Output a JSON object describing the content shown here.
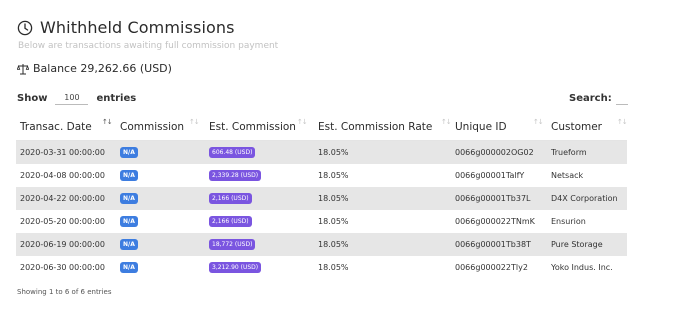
{
  "header": {
    "title": "Whithheld Commissions",
    "subtitle": "Below are transactions awaiting full commission payment"
  },
  "balance": {
    "text": "Balance 29,262.66 (USD)"
  },
  "controls": {
    "show_label": "Show",
    "entries_value": "100",
    "entries_label": "entries",
    "search_label": "Search:"
  },
  "table": {
    "columns": [
      "Transac. Date",
      "Commission",
      "Est. Commission",
      "Est. Commission Rate",
      "Unique ID",
      "Customer"
    ],
    "rows": [
      {
        "date": "2020-03-31 00:00:00",
        "commission": "N/A",
        "est_commission": "606.48 (USD)",
        "rate": "18.05%",
        "unique_id": "0066g000002OG02",
        "customer": "Trueform"
      },
      {
        "date": "2020-04-08 00:00:00",
        "commission": "N/A",
        "est_commission": "2,339.28 (USD)",
        "rate": "18.05%",
        "unique_id": "0066g00001TalfY",
        "customer": "Netsack"
      },
      {
        "date": "2020-04-22 00:00:00",
        "commission": "N/A",
        "est_commission": "2,166 (USD)",
        "rate": "18.05%",
        "unique_id": "0066g00001Tb37L",
        "customer": "D4X Corporation"
      },
      {
        "date": "2020-05-20 00:00:00",
        "commission": "N/A",
        "est_commission": "2,166 (USD)",
        "rate": "18.05%",
        "unique_id": "0066g000022TNmK",
        "customer": "Ensurion"
      },
      {
        "date": "2020-06-19 00:00:00",
        "commission": "N/A",
        "est_commission": "18,772 (USD)",
        "rate": "18.05%",
        "unique_id": "0066g00001Tb38T",
        "customer": "Pure Storage"
      },
      {
        "date": "2020-06-30 00:00:00",
        "commission": "N/A",
        "est_commission": "3,212.90 (USD)",
        "rate": "18.05%",
        "unique_id": "0066g000022Tly2",
        "customer": "Yoko Indus. Inc."
      }
    ]
  },
  "footer": {
    "info": "Showing 1 to 6 of 6 entries"
  },
  "colors": {
    "na_badge": "#3d7de0",
    "amount_badge": "#7a55e0",
    "row_stripe": "#e6e6e6"
  }
}
